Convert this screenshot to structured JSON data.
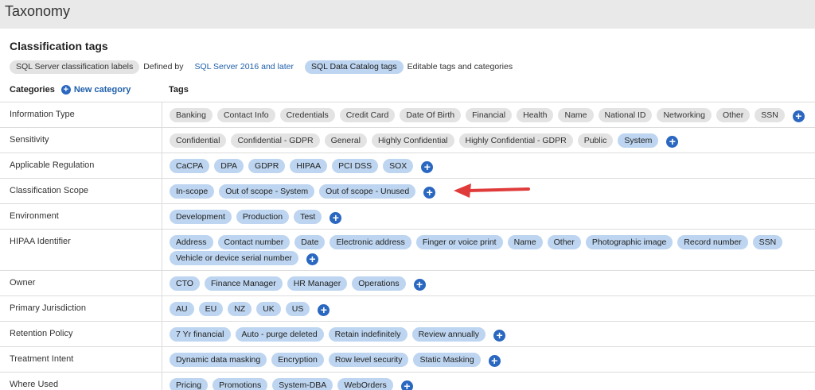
{
  "app": {
    "title": "Taxonomy"
  },
  "section": {
    "title": "Classification tags"
  },
  "legend": {
    "sql_label": "SQL Server classification labels",
    "defined_by": "Defined by",
    "defined_link": "SQL Server 2016 and later",
    "catalog_label": "SQL Data Catalog tags",
    "catalog_desc": "Editable tags and categories"
  },
  "columns": {
    "categories": "Categories",
    "new_category": "New category",
    "tags": "Tags"
  },
  "colors": {
    "grey_tag": "#e3e3e3",
    "blue_tag": "#bdd5f0",
    "accent": "#2a67c0",
    "arrow": "#e03b3b"
  },
  "rows": [
    {
      "category": "Information Type",
      "style": "grey",
      "tags": [
        "Banking",
        "Contact Info",
        "Credentials",
        "Credit Card",
        "Date Of Birth",
        "Financial",
        "Health",
        "Name",
        "National ID",
        "Networking",
        "Other",
        "SSN"
      ]
    },
    {
      "category": "Sensitivity",
      "style": "grey",
      "tags": [
        "Confidential",
        "Confidential - GDPR",
        "General",
        "Highly Confidential",
        "Highly Confidential - GDPR",
        "Public"
      ],
      "extra_blue": [
        "System"
      ]
    },
    {
      "category": "Applicable Regulation",
      "style": "blue",
      "tags": [
        "CaCPA",
        "DPA",
        "GDPR",
        "HIPAA",
        "PCI DSS",
        "SOX"
      ]
    },
    {
      "category": "Classification Scope",
      "style": "blue",
      "tags": [
        "In-scope",
        "Out of scope - System",
        "Out of scope - Unused"
      ]
    },
    {
      "category": "Environment",
      "style": "blue",
      "tags": [
        "Development",
        "Production",
        "Test"
      ]
    },
    {
      "category": "HIPAA Identifier",
      "style": "blue",
      "tags": [
        "Address",
        "Contact number",
        "Date",
        "Electronic address",
        "Finger or voice print",
        "Name",
        "Other",
        "Photographic image",
        "Record number",
        "SSN",
        "Vehicle or device serial number"
      ]
    },
    {
      "category": "Owner",
      "style": "blue",
      "tags": [
        "CTO",
        "Finance Manager",
        "HR Manager",
        "Operations"
      ]
    },
    {
      "category": "Primary Jurisdiction",
      "style": "blue",
      "tags": [
        "AU",
        "EU",
        "NZ",
        "UK",
        "US"
      ]
    },
    {
      "category": "Retention Policy",
      "style": "blue",
      "tags": [
        "7 Yr financial",
        "Auto - purge deleted",
        "Retain indefinitely",
        "Review annually"
      ]
    },
    {
      "category": "Treatment Intent",
      "style": "blue",
      "tags": [
        "Dynamic data masking",
        "Encryption",
        "Row level security",
        "Static Masking"
      ]
    },
    {
      "category": "Where Used",
      "style": "blue",
      "tags": [
        "Pricing",
        "Promotions",
        "System-DBA",
        "WebOrders"
      ]
    }
  ]
}
